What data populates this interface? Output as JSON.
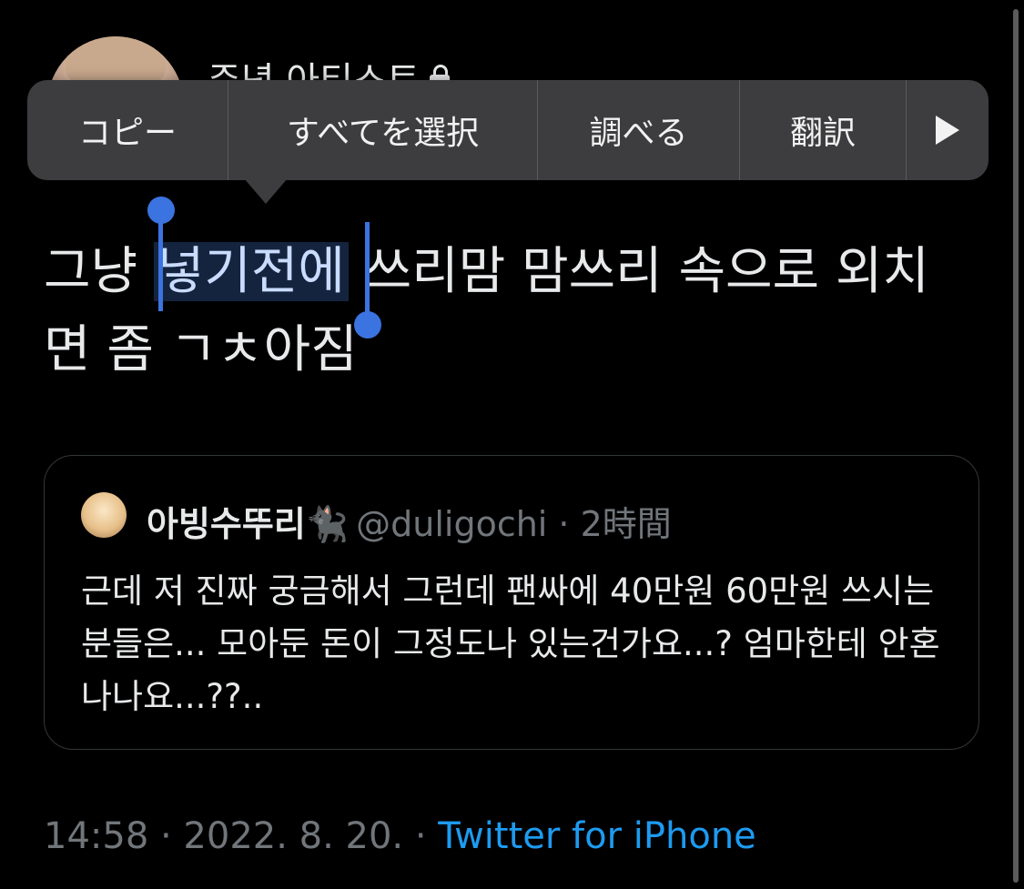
{
  "author": {
    "name": "주녕 아티스트"
  },
  "context_menu": {
    "copy": "コピー",
    "select_all": "すべてを選択",
    "look_up": "調べる",
    "translate": "翻訳"
  },
  "tweet": {
    "text_before": "그냥 ",
    "text_selected": "넣기전에",
    "text_after": " 쓰리맘 맘쓰리 속으로 외치면 좀 ㄱㅊ아짐"
  },
  "quote": {
    "name": "아빙수뚜리🐈‍⬛",
    "handle_time": "@duligochi · 2時間",
    "text": "근데 저 진짜 궁금해서 그런데 팬싸에 40만원 60만원 쓰시는 분들은... 모아둔 돈이 그정도나 있는건가요...? 엄마한테 안혼나나요...??.."
  },
  "footer": {
    "time_date": "14:58 · 2022. 8. 20. · ",
    "source": "Twitter for iPhone"
  }
}
